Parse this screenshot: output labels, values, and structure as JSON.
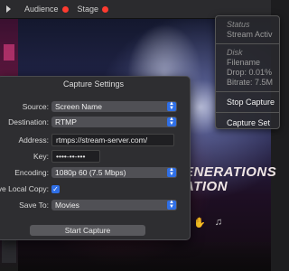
{
  "topbar": {
    "items": [
      {
        "label": "Audience",
        "status_color": "#ff3b30"
      },
      {
        "label": "Stage",
        "status_color": "#ff3b30"
      }
    ]
  },
  "stage_overlay": {
    "line1": "ENERATIONS",
    "line2": "ATION"
  },
  "status_menu": {
    "status_header": "Status",
    "status_value": "Stream Activ",
    "disk_header": "Disk",
    "disk_filename": "Filename",
    "disk_drop": "Drop: 0.01%",
    "disk_bitrate": "Bitrate: 7.5M",
    "stop_capture": "Stop Capture",
    "capture_settings": "Capture Set"
  },
  "dialog": {
    "title": "Capture Settings",
    "source": {
      "label": "Source:",
      "value": "Screen Name"
    },
    "destination": {
      "label": "Destination:",
      "value": "RTMP"
    },
    "address": {
      "label": "Address:",
      "value": "rtmps://stream-server.com/"
    },
    "key": {
      "label": "Key:",
      "value": "••••-••-•••"
    },
    "encoding": {
      "label": "Encoding:",
      "value": "1080p 60 (7.5 Mbps)"
    },
    "local_copy": {
      "label": "ve Local Copy:",
      "checked": true
    },
    "save_to": {
      "label": "Save To:",
      "value": "Movies"
    },
    "start_button": "Start Capture"
  },
  "bottom": {
    "icons": [
      "hand-icon",
      "music-note-icon"
    ]
  },
  "colors": {
    "accent": "#2f6fe6",
    "live_dot": "#ff3b30"
  }
}
